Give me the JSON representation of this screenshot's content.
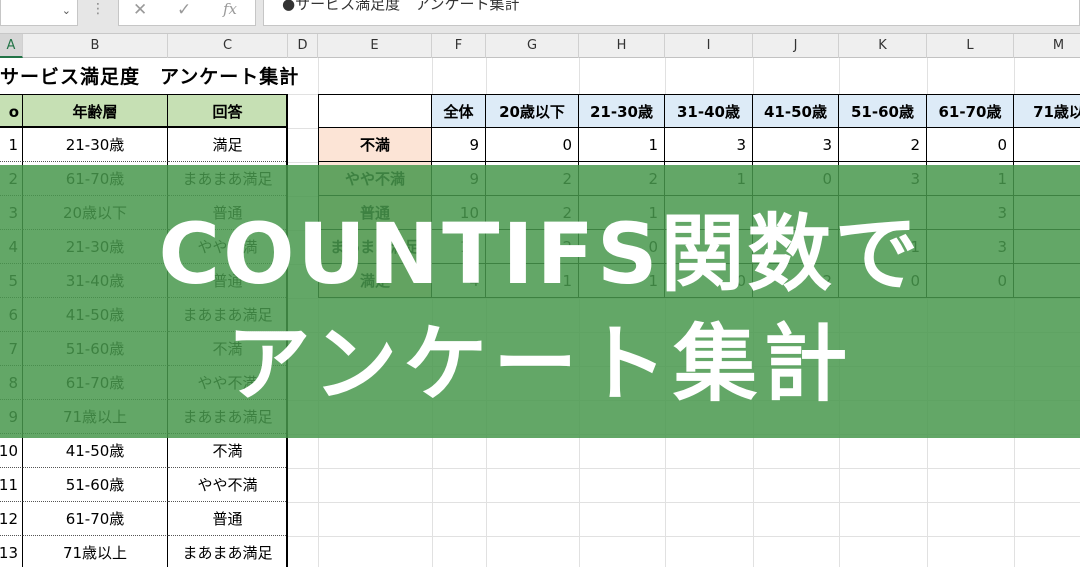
{
  "formula_bar": {
    "fx": "fx",
    "content": "●サービス満足度　アンケート集計"
  },
  "columns": [
    "A",
    "B",
    "C",
    "D",
    "E",
    "F",
    "G",
    "H",
    "I",
    "J",
    "K",
    "L",
    "M"
  ],
  "sheet": {
    "title": "サービス満足度　アンケート集計",
    "left_table": {
      "headers": [
        "o",
        "年齢層",
        "回答"
      ],
      "rows": [
        {
          "no": "1",
          "age": "21-30歳",
          "answer": "満足"
        },
        {
          "no": "2",
          "age": "61-70歳",
          "answer": "まあまあ満足"
        },
        {
          "no": "3",
          "age": "20歳以下",
          "answer": "普通"
        },
        {
          "no": "4",
          "age": "21-30歳",
          "answer": "やや不満"
        },
        {
          "no": "5",
          "age": "31-40歳",
          "answer": "普通"
        },
        {
          "no": "6",
          "age": "41-50歳",
          "answer": "まあまあ満足"
        },
        {
          "no": "7",
          "age": "51-60歳",
          "answer": "不満"
        },
        {
          "no": "8",
          "age": "61-70歳",
          "answer": "やや不満"
        },
        {
          "no": "9",
          "age": "71歳以上",
          "answer": "まあまあ満足"
        },
        {
          "no": "10",
          "age": "41-50歳",
          "answer": "不満"
        },
        {
          "no": "11",
          "age": "51-60歳",
          "answer": "やや不満"
        },
        {
          "no": "12",
          "age": "61-70歳",
          "answer": "普通"
        },
        {
          "no": "13",
          "age": "71歳以上",
          "answer": "まあまあ満足"
        }
      ]
    },
    "summary_table": {
      "headers": [
        "全体",
        "20歳以下",
        "21-30歳",
        "31-40歳",
        "41-50歳",
        "51-60歳",
        "61-70歳",
        "71歳以"
      ],
      "rows": [
        {
          "label": "不満",
          "values": [
            "9",
            "0",
            "1",
            "3",
            "3",
            "2",
            "0",
            ""
          ]
        },
        {
          "label": "やや不満",
          "values": [
            "9",
            "2",
            "2",
            "1",
            "0",
            "3",
            "1",
            ""
          ]
        },
        {
          "label": "普通",
          "values": [
            "10",
            "2",
            "1",
            "",
            "",
            "",
            "3",
            ""
          ]
        },
        {
          "label": "まあまあ満足",
          "values": [
            "12",
            "2",
            "0",
            "",
            "",
            "1",
            "3",
            ""
          ]
        },
        {
          "label": "満足",
          "values": [
            "4",
            "1",
            "1",
            "0",
            "2",
            "0",
            "0",
            ""
          ]
        }
      ]
    }
  },
  "banner": {
    "line1": "COUNTIFS関数で",
    "line2": "アンケート集計",
    "color": "#48984c"
  }
}
